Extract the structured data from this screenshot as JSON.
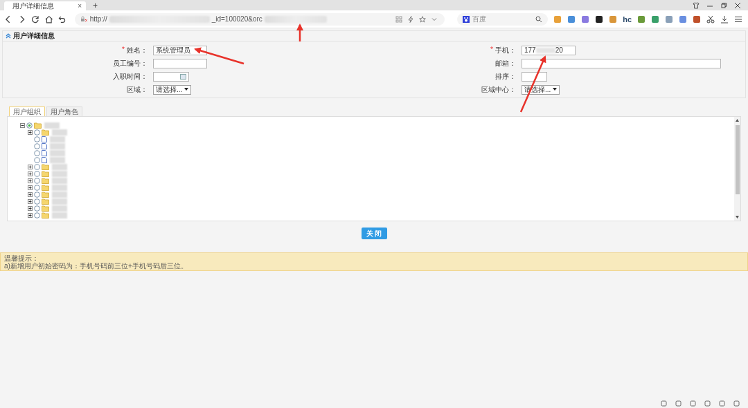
{
  "browser": {
    "tab_title": "用户详细信息",
    "tab_close": "×",
    "new_tab": "+",
    "url_prefix": "http://",
    "url_fragment": "_id=100020&orc",
    "search_placeholder": "百度",
    "ext_label": "hc"
  },
  "panel": {
    "title": "用户详细信息"
  },
  "form": {
    "required_mark": "*",
    "left": [
      {
        "label": "姓名：",
        "required": true,
        "kind": "text",
        "value": "系统管理员"
      },
      {
        "label": "员工编号：",
        "required": false,
        "kind": "text"
      },
      {
        "label": "入职时间：",
        "required": false,
        "kind": "date"
      },
      {
        "label": "区域：",
        "required": false,
        "kind": "select",
        "value": "请选择..."
      }
    ],
    "right": [
      {
        "label": "手机：",
        "required": true,
        "kind": "masked",
        "value_start": "177",
        "value_end": "20"
      },
      {
        "label": "邮箱：",
        "required": false,
        "kind": "text"
      },
      {
        "label": "排序：",
        "required": false,
        "kind": "text"
      },
      {
        "label": "区域中心：",
        "required": false,
        "kind": "select",
        "value": "请选择..."
      }
    ]
  },
  "tabs": [
    {
      "label": "用户组织",
      "selected": true
    },
    {
      "label": "用户角色",
      "selected": false
    }
  ],
  "tree": [
    {
      "kind": "folder",
      "expanded": true,
      "selected": true,
      "children": [
        {
          "kind": "folder",
          "expanded": false,
          "selected": false
        },
        {
          "kind": "file",
          "selected": false
        },
        {
          "kind": "file",
          "selected": false
        },
        {
          "kind": "file",
          "selected": false
        },
        {
          "kind": "file",
          "selected": false
        },
        {
          "kind": "folder",
          "expanded": false,
          "selected": false
        },
        {
          "kind": "folder",
          "expanded": false,
          "selected": false
        },
        {
          "kind": "folder",
          "expanded": false,
          "selected": false
        },
        {
          "kind": "folder",
          "expanded": false,
          "selected": false
        },
        {
          "kind": "folder",
          "expanded": false,
          "selected": false
        },
        {
          "kind": "folder",
          "expanded": false,
          "selected": false
        },
        {
          "kind": "folder",
          "expanded": false,
          "selected": false
        },
        {
          "kind": "folder",
          "expanded": false,
          "selected": false
        }
      ]
    }
  ],
  "close_button": "关 闭",
  "tips": {
    "title": "温馨提示：",
    "text": "a)新增用户初始密码为：手机号码前三位+手机号码后三位。"
  }
}
